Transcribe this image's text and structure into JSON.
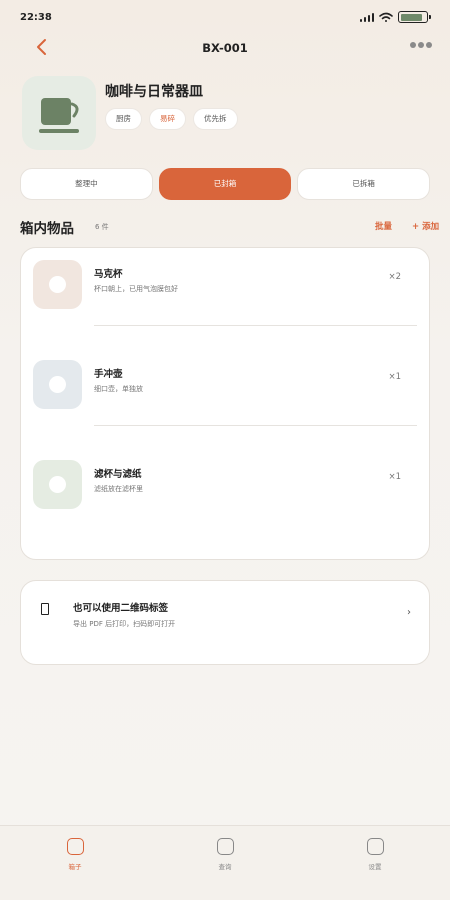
{
  "status_bar": {
    "time": "22:38"
  },
  "header": {
    "title": "BX-001"
  },
  "box": {
    "title": "咖啡与日常器皿",
    "tags": [
      {
        "label": "厨房",
        "style": "normal"
      },
      {
        "label": "易碎",
        "style": "warn"
      },
      {
        "label": "优先拆",
        "style": "normal"
      }
    ]
  },
  "status_tabs": [
    {
      "label": "整理中",
      "active": false
    },
    {
      "label": "已封箱",
      "active": true
    },
    {
      "label": "已拆箱",
      "active": false
    }
  ],
  "section": {
    "title": "箱内物品",
    "count": "6 件",
    "batch_label": "批量",
    "add_label": "+ 添加"
  },
  "items": [
    {
      "name": "马克杯",
      "note": "杯口朝上，已用气泡膜包好",
      "qty": "×2",
      "thumb_color": "#f1e6df"
    },
    {
      "name": "手冲壶",
      "note": "细口壶，单独放",
      "qty": "×1",
      "thumb_color": "#e4e9ed"
    },
    {
      "name": "滤杯与滤纸",
      "note": "滤纸放在滤杯里",
      "qty": "×1",
      "thumb_color": "#e5ece2"
    }
  ],
  "qr": {
    "title": "也可以使用二维码标签",
    "subtitle": "导出 PDF 后打印，扫码即可打开"
  },
  "nav": [
    {
      "label": "箱子",
      "active": true
    },
    {
      "label": "查询",
      "active": false
    },
    {
      "label": "设置",
      "active": false
    }
  ],
  "colors": {
    "accent": "#d9653b",
    "cup": "#6c8265"
  }
}
